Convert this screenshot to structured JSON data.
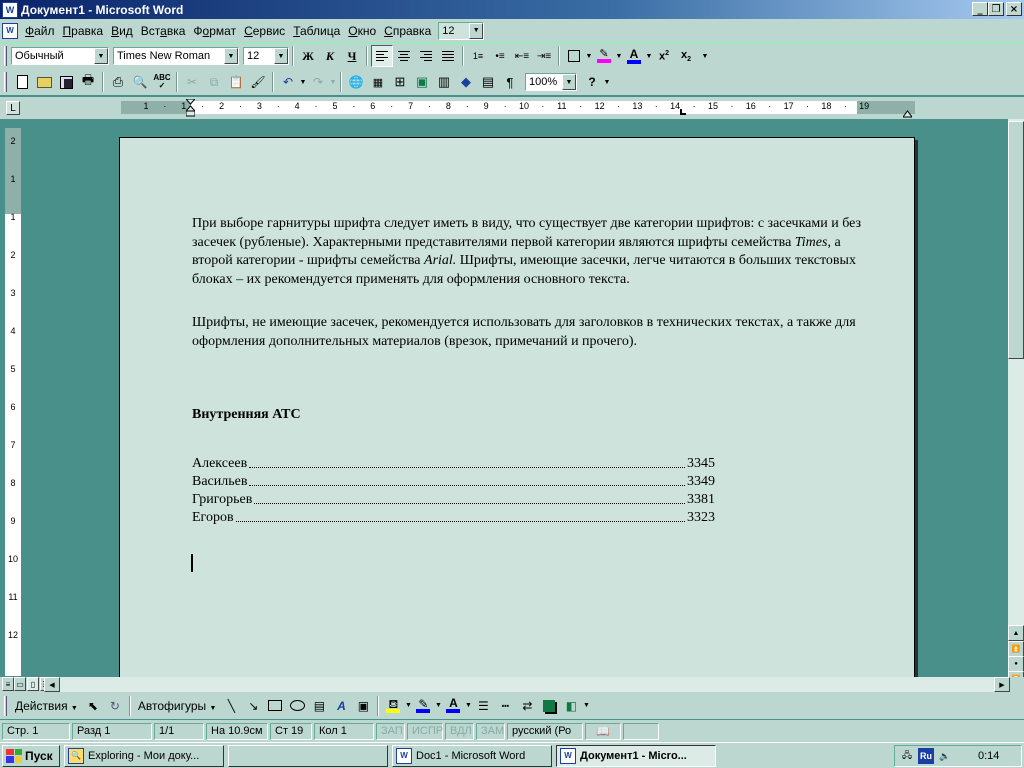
{
  "window": {
    "title": "Документ1 - Microsoft Word",
    "icon": "word-doc-icon"
  },
  "menubar": {
    "items": [
      {
        "label": "Файл",
        "accel": "Ф",
        "rest": "айл"
      },
      {
        "label": "Правка",
        "accel": "П",
        "rest": "равка"
      },
      {
        "label": "Вид",
        "accel": "В",
        "rest": "ид"
      },
      {
        "label": "Вставка",
        "accel": "а",
        "pre": "Вст",
        "rest": "вка"
      },
      {
        "label": "Формат",
        "accel": "о",
        "pre": "Ф",
        "rest": "рмат"
      },
      {
        "label": "Сервис",
        "accel": "С",
        "rest": "ервис"
      },
      {
        "label": "Таблица",
        "accel": "Т",
        "rest": "аблица"
      },
      {
        "label": "Окно",
        "accel": "О",
        "rest": "кно"
      },
      {
        "label": "Справка",
        "accel": "С",
        "rest": "правка"
      }
    ],
    "size_combo": "12"
  },
  "formatting": {
    "style": "Обычный",
    "font": "Times New Roman",
    "size": "12",
    "bold": "Ж",
    "italic": "К",
    "underline": "Ч",
    "highlight_color": "#ff00ff",
    "font_color": "#0000ff"
  },
  "standard": {
    "zoom": "100%"
  },
  "ruler": {
    "h_labels": [
      "1",
      "·",
      "1",
      "·",
      "2",
      "·",
      "3",
      "·",
      "4",
      "·",
      "5",
      "·",
      "6",
      "·",
      "7",
      "·",
      "8",
      "·",
      "9",
      "·",
      "10",
      "·",
      "11",
      "·",
      "12",
      "·",
      "13",
      "·",
      "14",
      "·",
      "15",
      "·",
      "16",
      "·",
      "17",
      "·",
      "18",
      "·",
      "19"
    ],
    "v_labels": [
      "2",
      "1",
      "1",
      "2",
      "3",
      "4",
      "5",
      "6",
      "7",
      "8",
      "9",
      "10",
      "11",
      "12"
    ]
  },
  "document": {
    "para1_a": "При выборе гарнитуры шрифта следует иметь в виду, что существует две категории шрифтов: с засечками и без засечек (рубленые). Характерными представителями первой категории являются шрифты семейства ",
    "para1_times": "Times",
    "para1_b": ", а второй категории  - шрифты семейства ",
    "para1_arial": "Arial.",
    "para1_c": " Шрифты, имеющие засечки, легче читаются в больших текстовых блоках – их рекомендуется применять для оформления основного текста.",
    "para2": "Шрифты, не имеющие засечек, рекомендуется использовать для заголовков в технических текстах, а также для оформления дополнительных материалов (врезок, примечаний и прочего).",
    "heading": "Внутренняя АТС",
    "entries": [
      {
        "name": "Алексеев",
        "phone": "3345"
      },
      {
        "name": "Васильев",
        "phone": "3349"
      },
      {
        "name": "Григорьев",
        "phone": "3381"
      },
      {
        "name": "Егоров",
        "phone": "3323"
      }
    ]
  },
  "drawing": {
    "actions": "Действия",
    "autoshapes": "Автофигуры",
    "fill_color": "#ffff00",
    "line_color": "#0000ff",
    "font_color": "#0000ff"
  },
  "status": {
    "page": "Стр. 1",
    "section": "Разд 1",
    "pages": "1/1",
    "at": "На 10.9см",
    "line": "Ст 19",
    "col": "Кол 1",
    "rec": "ЗАП",
    "trk": "ИСПР",
    "ext": "ВДЛ",
    "ovr": "ЗАМ",
    "lang": "русский (Ро"
  },
  "taskbar": {
    "start": "Пуск",
    "tasks": [
      {
        "label": "Exploring - Мои доку...",
        "icon": "explorer-icon"
      },
      {
        "label": "",
        "icon": ""
      },
      {
        "label": "Doc1 - Microsoft Word",
        "icon": "word-icon"
      },
      {
        "label": "Документ1 - Micro...",
        "icon": "word-icon"
      }
    ],
    "lang_indicator": "Ru",
    "clock": "0:14"
  }
}
